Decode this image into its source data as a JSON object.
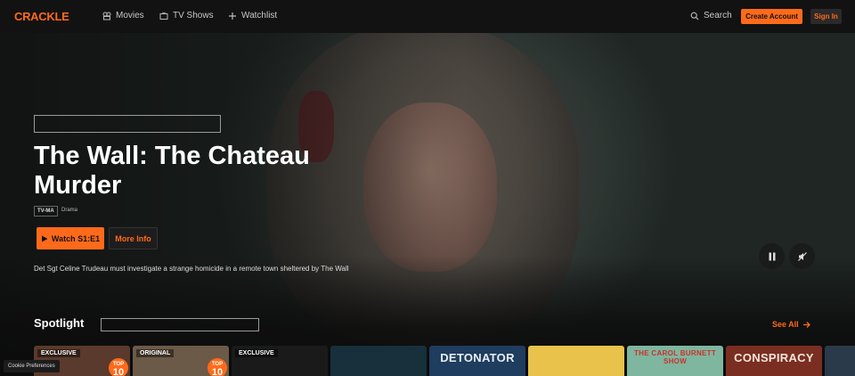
{
  "nav": {
    "logo": "CRACKLE",
    "items": [
      {
        "label": "Movies",
        "icon": "movies-icon"
      },
      {
        "label": "TV Shows",
        "icon": "tv-icon"
      },
      {
        "label": "Watchlist",
        "icon": "plus-icon"
      }
    ],
    "search_label": "Search",
    "create_account": "Create Account",
    "sign_in": "Sign In"
  },
  "hero": {
    "title": "The Wall: The Chateau Murder",
    "rating": "TV-MA",
    "genre": "Drama",
    "watch_label": "Watch S1:E1",
    "more_info_label": "More Info",
    "description": "Det Sgt Celine Trudeau must investigate a strange homicide in a remote town sheltered by The Wall",
    "controls": {
      "pause": "pause-icon",
      "mute": "mute-icon"
    }
  },
  "spotlight": {
    "title": "Spotlight",
    "see_all": "See All",
    "cards": [
      {
        "badge": "EXCLUSIVE",
        "top10": true,
        "top_label": "TOP",
        "top_num": "10",
        "title": "",
        "bg": "#5a3a2c"
      },
      {
        "badge": "ORIGINAL",
        "top10": true,
        "top_label": "TOP",
        "top_num": "10",
        "title": "",
        "bg": "#6c5a48"
      },
      {
        "badge": "EXCLUSIVE",
        "top10": false,
        "title": "",
        "bg": "#1a1a1a"
      },
      {
        "badge": "",
        "top10": false,
        "title": "",
        "bg": "#17303c"
      },
      {
        "badge": "",
        "top10": false,
        "title": "DETONATOR",
        "title_color": "#e9eef4",
        "bg": "#1f3d5e"
      },
      {
        "badge": "",
        "top10": false,
        "title": "",
        "bg": "#e8c24a"
      },
      {
        "badge": "",
        "top10": false,
        "title": "THE CAROL BURNETT SHOW",
        "title_color": "#c8332a",
        "bg": "#7fb6a0"
      },
      {
        "badge": "",
        "top10": false,
        "title": "CONSPIRACY",
        "title_color": "#f0e6d8",
        "bg": "#7a2e22"
      },
      {
        "badge": "",
        "top10": false,
        "title": "",
        "bg": "#2a3a4a"
      }
    ]
  },
  "cookie": "Cookie Preferences",
  "colors": {
    "accent": "#ff6a1a",
    "nav_bg": "#121212",
    "page_bg": "#0b0b0b"
  }
}
